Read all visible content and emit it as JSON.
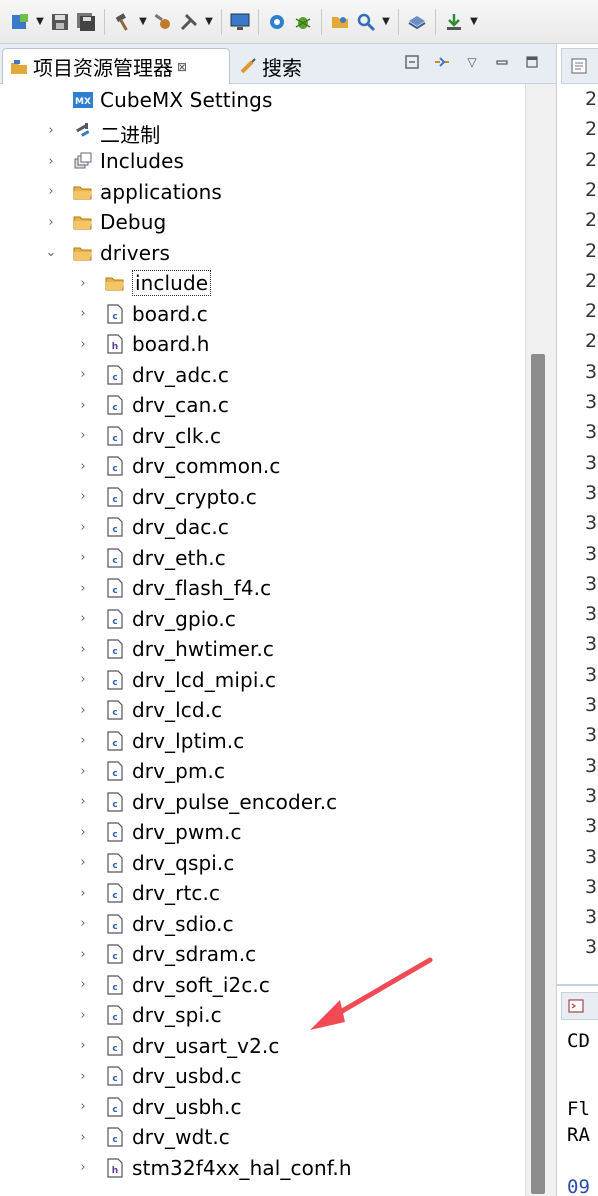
{
  "panel": {
    "tab_explorer": "项目资源管理器",
    "tab_explorer_close": "⊠",
    "tab_search": "搜索"
  },
  "tree": [
    {
      "label": "CubeMX Settings",
      "icon": "cubemx-icon",
      "level": 1,
      "chevron": ""
    },
    {
      "label": "二进制",
      "icon": "binaries-icon",
      "level": 1,
      "chevron": "›"
    },
    {
      "label": "Includes",
      "icon": "includes-icon",
      "level": 1,
      "chevron": "›"
    },
    {
      "label": "applications",
      "icon": "folder-icon",
      "level": 1,
      "chevron": "›"
    },
    {
      "label": "Debug",
      "icon": "folder-icon",
      "level": 1,
      "chevron": "›"
    },
    {
      "label": "drivers",
      "icon": "folder-icon",
      "level": 1,
      "chevron": "⌄"
    },
    {
      "label": "include",
      "icon": "folder-icon",
      "level": 2,
      "chevron": "›",
      "selected": true
    },
    {
      "label": "board.c",
      "icon": "c-file-icon",
      "level": 2,
      "chevron": "›"
    },
    {
      "label": "board.h",
      "icon": "h-file-icon",
      "level": 2,
      "chevron": "›"
    },
    {
      "label": "drv_adc.c",
      "icon": "c-file-icon",
      "level": 2,
      "chevron": "›"
    },
    {
      "label": "drv_can.c",
      "icon": "c-file-icon",
      "level": 2,
      "chevron": "›"
    },
    {
      "label": "drv_clk.c",
      "icon": "c-file-icon",
      "level": 2,
      "chevron": "›"
    },
    {
      "label": "drv_common.c",
      "icon": "c-file-icon",
      "level": 2,
      "chevron": "›"
    },
    {
      "label": "drv_crypto.c",
      "icon": "c-file-icon",
      "level": 2,
      "chevron": "›"
    },
    {
      "label": "drv_dac.c",
      "icon": "c-file-icon",
      "level": 2,
      "chevron": "›"
    },
    {
      "label": "drv_eth.c",
      "icon": "c-file-icon",
      "level": 2,
      "chevron": "›"
    },
    {
      "label": "drv_flash_f4.c",
      "icon": "c-file-icon",
      "level": 2,
      "chevron": "›"
    },
    {
      "label": "drv_gpio.c",
      "icon": "c-file-icon",
      "level": 2,
      "chevron": "›"
    },
    {
      "label": "drv_hwtimer.c",
      "icon": "c-file-icon",
      "level": 2,
      "chevron": "›"
    },
    {
      "label": "drv_lcd_mipi.c",
      "icon": "c-file-icon",
      "level": 2,
      "chevron": "›"
    },
    {
      "label": "drv_lcd.c",
      "icon": "c-file-icon",
      "level": 2,
      "chevron": "›"
    },
    {
      "label": "drv_lptim.c",
      "icon": "c-file-icon",
      "level": 2,
      "chevron": "›"
    },
    {
      "label": "drv_pm.c",
      "icon": "c-file-icon",
      "level": 2,
      "chevron": "›"
    },
    {
      "label": "drv_pulse_encoder.c",
      "icon": "c-file-icon",
      "level": 2,
      "chevron": "›"
    },
    {
      "label": "drv_pwm.c",
      "icon": "c-file-icon",
      "level": 2,
      "chevron": "›"
    },
    {
      "label": "drv_qspi.c",
      "icon": "c-file-icon",
      "level": 2,
      "chevron": "›"
    },
    {
      "label": "drv_rtc.c",
      "icon": "c-file-icon",
      "level": 2,
      "chevron": "›"
    },
    {
      "label": "drv_sdio.c",
      "icon": "c-file-icon",
      "level": 2,
      "chevron": "›"
    },
    {
      "label": "drv_sdram.c",
      "icon": "c-file-icon",
      "level": 2,
      "chevron": "›"
    },
    {
      "label": "drv_soft_i2c.c",
      "icon": "c-file-icon",
      "level": 2,
      "chevron": "›"
    },
    {
      "label": "drv_spi.c",
      "icon": "c-file-icon",
      "level": 2,
      "chevron": "›"
    },
    {
      "label": "drv_usart_v2.c",
      "icon": "c-file-icon",
      "level": 2,
      "chevron": "›"
    },
    {
      "label": "drv_usbd.c",
      "icon": "c-file-icon",
      "level": 2,
      "chevron": "›"
    },
    {
      "label": "drv_usbh.c",
      "icon": "c-file-icon",
      "level": 2,
      "chevron": "›"
    },
    {
      "label": "drv_wdt.c",
      "icon": "c-file-icon",
      "level": 2,
      "chevron": "›"
    },
    {
      "label": "stm32f4xx_hal_conf.h",
      "icon": "h-file-icon",
      "level": 2,
      "chevron": "›"
    }
  ],
  "editor": {
    "line_numbers": [
      "2",
      "2",
      "2",
      "2",
      "2",
      "2",
      "2",
      "2",
      "2",
      "3",
      "3",
      "3",
      "3",
      "3",
      "3",
      "3",
      "3",
      "3",
      "3",
      "3",
      "3",
      "3",
      "3",
      "3",
      "3",
      "3",
      "3",
      "3",
      "3"
    ]
  },
  "console": {
    "tab_label": "CD",
    "line1": "Fl",
    "line2": "RA",
    "line3": "09"
  }
}
